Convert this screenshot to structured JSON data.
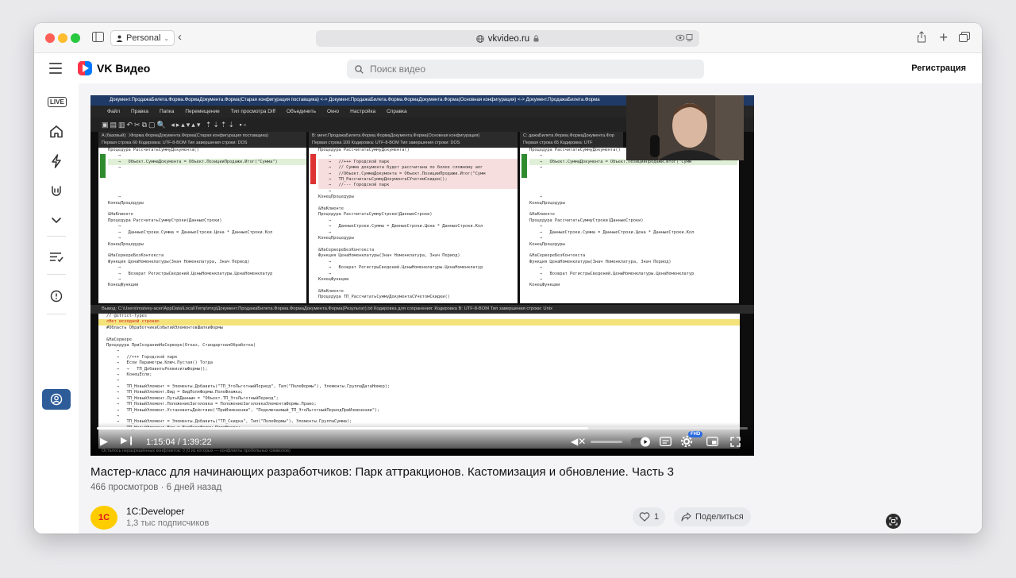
{
  "browser": {
    "profile": "Personal",
    "url": "vkvideo.ru"
  },
  "header": {
    "logo_text": "VK Видео",
    "search_placeholder": "Поиск видео",
    "signup_label": "Регистрация"
  },
  "sidebar": {
    "live_label": "LIVE",
    "icons": [
      "live-icon",
      "home-icon",
      "lightning-icon",
      "hands-icon",
      "chevron-down-icon",
      "subscriptions-icon",
      "info-icon",
      "profile-icon"
    ]
  },
  "editor": {
    "title": "Документ.ПродажаБилета.Форма.ФормаДокумента.Форма(Старая конфигурация поставщика) <-> Документ.ПродажаБилета.Форма.ФормаДокумента.Форма(Основная конфигурация) <-> Документ.ПродажаБилета.Форма",
    "menu": [
      "Файл",
      "Правка",
      "Папка",
      "Перемещение",
      "Тип просмотра Diff",
      "Объединить",
      "Окно",
      "Настройка",
      "Справка"
    ],
    "pane_a_header": "A (базовый): .\\Форма.ФормаДокумента.Форма(Старая конфигурация поставщика)",
    "pane_a_info": "Первая строка 60        Кодировка: UTF-8-BOM        Тип завершения строки: DOS",
    "pane_b_header": "B: мент.ПродажаБилета.Форма.ФормаДокумента.Форма(Основная конфигурация)",
    "pane_b_info": "Первая строка 100        Кодировка: UTF-8-BOM        Тип завершения строки: DOS",
    "pane_c_header": "C: дажаБилета.Форма.ФормаДокумента.Фор",
    "pane_c_info": "Первая строка 65        Кодировка: UTF",
    "pane_a_code": "Процедура РассчитатьСуммуДокумента()\n    →\n    →   Объект.СуммаДокумента = Объект.ПозицииПродажи.Итог(\"Сумма\")\n    →\n\n\n\n\n    →\nКонецПроцедуры\n\n&НаКлиенте\nПроцедура РассчитатьСуммуСтроки(ДанныеСтроки)\n    →\n    →   ДанныеСтроки.Сумма = ДанныеСтроки.Цена * ДанныеСтроки.Кол\n    →\nКонецПроцедуры\n\n&НаСервереБезКонтекста\nФункция ЦенаНоменклатуры(Знач Номенклатура, Знач Период)\n    →\n    →   Возврат РегистрыСведений.ЦеныНоменклатуры.ЦенаНоменклатур\n    →\nКонецФункции",
    "pane_b_code": "Процедура РассчитатьСуммуДокумента()\n    →\n    →   //+++ Городской парк\n    →   // Сумма документа будет рассчитана по более сложному алг\n    →   //Объект.СуммаДокумента = Объект.ПозицииПродажи.Итог(\"Сумм\n    →   ТП_РассчитатьСуммуДокументаСУчетомСкидки();\n    →   //--- Городской парк\n    →\nКонецПроцедуры\n\n&НаКлиенте\nПроцедура РассчитатьСуммуСтроки(ДанныеСтроки)\n    →\n    →   ДанныеСтроки.Сумма = ДанныеСтроки.Цена * ДанныеСтроки.Кол\n    →\nКонецПроцедуры\n\n&НаСервереБезКонтекста\nФункция ЦенаНоменклатуры(Знач Номенклатура, Знач Период)\n    →\n    →   Возврат РегистрыСведений.ЦеныНоменклатуры.ЦенаНоменклатур\n    →\nКонецФункции\n\n&НаКлиенте\nПроцедура ТП_РассчитатьСуммуДокументаСУчетомСкидки()",
    "pane_c_code": "Процедура РассчитатьСуммуДокумента()\n    →\n    →   Объект.СуммаДокумента = Объект.ПозицииПродажи.Итог(\"Сумм\n    →\n\n\n\n\n    →\nКонецПроцедуры\n\n&НаКлиенте\nПроцедура РассчитатьСуммуСтроки(ДанныеСтроки)\n    →\n    →   ДанныеСтроки.Сумма = ДанныеСтроки.Цена * ДанныеСтроки.Кол\n    →\nКонецПроцедуры\n\n&НаСервереБезКонтекста\nФункция ЦенаНоменклатуры(Знач Номенклатура, Знач Период)\n    →\n    →   Возврат РегистрыСведений.ЦеныНоменклатуры.ЦенаНоменклатур\n    →\nКонецФункции",
    "output_header": "Вывод:  C:\\Users\\matvey-acer\\AppData\\Local\\Temp\\mrg\\Документ.ПродажаБилета.Форма.ФормаДокумента.Форма(Результат).txt          Кодировка для сохранения:  Кодировка В: UTF-8-BOM        Тип завершения строки:  Unix",
    "output_first": "// @strict-types",
    "output_conflict": "<Нет исходной строки>",
    "output_code": "#Область ОбработчикиСобытийЭлементовШапкиФормы\n\n&НаСервере\nПроцедура ПриСозданииНаСервере(Отказ, СтандартнаяОбработка)\n    →\n    →   //+++ Городской парк\n    →   Если Параметры.Ключ.Пустая() Тогда\n    →   →   ТП_ДобавитьРеквизитыФормы();\n    →   КонецЕсли;\n    →\n    →   ТП_НовыйЭлемент = Элементы.Добавить(\"ТП_ЭтоЛьготныйПериод\", Тип(\"ПолеФормы\"), Элементы.ГруппаДатаНомер);\n    →   ТП_НовыйЭлемент.Вид = ВидПоляФормы.ПолеФлажка;\n    →   ТП_НовыйЭлемент.ПутьКДанным = \"Объект.ТП_ЭтоЛьготныйПериод\";\n    →   ТП_НовыйЭлемент.ПоложениеЗаголовка = ПоложениеЗаголовкаЭлементаФормы.Право;\n    →   ТП_НовыйЭлемент.УстановитьДействие(\"ПриИзменении\", \"Подключаемый_ТП_ЭтоЛьготныйПериодПриИзменении\");\n    →\n    →   ТП_НовыйЭлемент = Элементы.Добавить(\"ТП_Скидка\", Тип(\"ПолеФормы\"), Элементы.ГруппаСумма);\n    →   ТП_НовыйЭлемент.Вид = ВидПоляФормы.ПолеВвода;",
    "status": "Осталось неразрешённых конфликтов: 0 (0 из которых — конфликты пробельных символов)"
  },
  "player": {
    "time_display": "1:15:04 / 1:39:22",
    "progress_fraction": 0.755,
    "hd_badge": "FHD"
  },
  "video": {
    "title": "Мастер-класс для начинающих разработчиков: Парк аттракционов. Кастомизация и обновление. Часть 3",
    "views": "466 просмотров",
    "age": "6 дней назад",
    "separator": " · "
  },
  "channel": {
    "logo_text": "1С",
    "name": "1C:Developer",
    "subscribers": "1,3 тыс подписчиков"
  },
  "actions": {
    "likes": "1",
    "share_label": "Поделиться"
  }
}
